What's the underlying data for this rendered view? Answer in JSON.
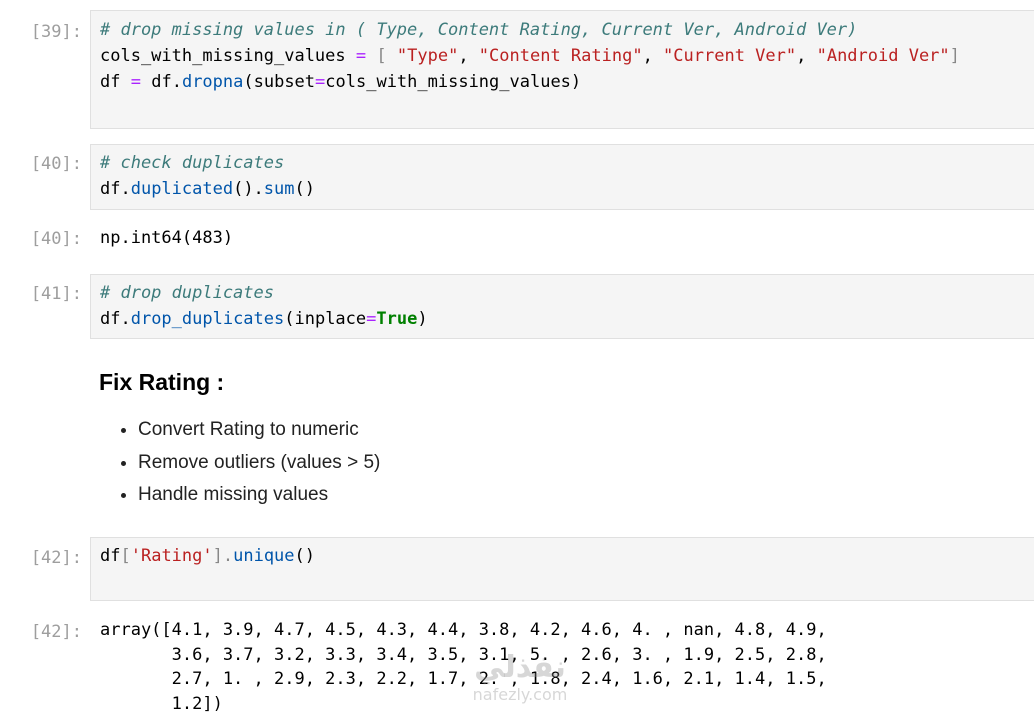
{
  "cells": {
    "c39": {
      "prompt": "[39]:",
      "line1_comment": "# drop missing values in ( Type, Content Rating, Current Ver, Android Ver)",
      "line2_var": "cols_with_missing_values",
      "line2_eq": "=",
      "line2_open": "[",
      "line2_s1": "\"Type\"",
      "line2_s2": "\"Content Rating\"",
      "line2_s3": "\"Current Ver\"",
      "line2_s4": "\"Android Ver\"",
      "line2_close": "]",
      "line3_df": "df",
      "line3_eq": "=",
      "line3_df2": "df.",
      "line3_fn": "dropna",
      "line3_arg_open": "(subset",
      "line3_arg_eq": "=",
      "line3_arg_rest": "cols_with_missing_values)"
    },
    "c40": {
      "prompt": "[40]:",
      "line1_comment": "# check duplicates",
      "line2_df": "df.",
      "line2_fn1": "duplicated",
      "line2_mid": "().",
      "line2_fn2": "sum",
      "line2_end": "()"
    },
    "o40": {
      "prompt": "[40]:",
      "text": "np.int64(483)"
    },
    "c41": {
      "prompt": "[41]:",
      "line1_comment": "# drop duplicates",
      "line2_df": "df.",
      "line2_fn": "drop_duplicates",
      "line2_arg": "(inplace",
      "line2_eq": "=",
      "line2_kw": "True",
      "line2_end": ")"
    },
    "markdown": {
      "title_bold": "Fix Rating",
      "title_rest": " :",
      "items": [
        "Convert Rating to numeric",
        "Remove outliers (values > 5)",
        "Handle missing values"
      ]
    },
    "c42": {
      "prompt": "[42]:",
      "df": "df",
      "open": "[",
      "str": "'Rating'",
      "close": "].",
      "fn": "unique",
      "end": "()"
    },
    "o42": {
      "prompt": "[42]:",
      "text": "array([4.1, 3.9, 4.7, 4.5, 4.3, 4.4, 3.8, 4.2, 4.6, 4. , nan, 4.8, 4.9,\n       3.6, 3.7, 3.2, 3.3, 3.4, 3.5, 3.1, 5. , 2.6, 3. , 1.9, 2.5, 2.8,\n       2.7, 1. , 2.9, 2.3, 2.2, 1.7, 2. , 1.8, 2.4, 1.6, 2.1, 1.4, 1.5,\n       1.2])"
    }
  },
  "watermark": {
    "arabic": "نفذلي",
    "latin": "nafezly.com"
  }
}
